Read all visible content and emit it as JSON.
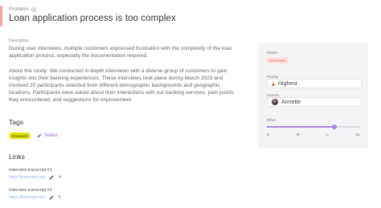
{
  "breadcrumb": {
    "label": "Problem"
  },
  "title": "Loan application process is too complex",
  "description": {
    "label": "Description",
    "paragraph1": "During user interviews, multiple customers expressed frustration with the complexity of the loan application process, especially the documentation required.",
    "paragraph2": "About this study: We conducted in-depth interviews with a diverse group of customers to gain insights into their banking experiences. These interviews took place during March 2023 and involved 20 participants selected from different demographic backgrounds and geographic locations. Participants were asked about their interactions with our banking services, pain points they encountered, and suggestions for improvement."
  },
  "tags": {
    "heading": "Tags",
    "items": [
      "Research"
    ],
    "select_label": "Select",
    "tag_color": "#e4e400"
  },
  "links": {
    "heading": "Links",
    "items": [
      {
        "title": "Interview transcript #1",
        "url": "https://transcript.one"
      },
      {
        "title": "Interview transcript #2",
        "url": "https://transcript.two"
      }
    ]
  },
  "panel": {
    "status": {
      "label": "Status",
      "value": "PENDING",
      "color": "#e0644e"
    },
    "priority": {
      "label": "Priority",
      "value": "Highest",
      "icon": "arrow-up-icon"
    },
    "owners": {
      "label": "Owners",
      "value": "Annette"
    },
    "effort": {
      "label": "Effort",
      "ticks": [
        "S",
        "M",
        "L",
        "XL"
      ],
      "value": "L",
      "fraction": 0.72,
      "accent": "#b183e6"
    }
  }
}
